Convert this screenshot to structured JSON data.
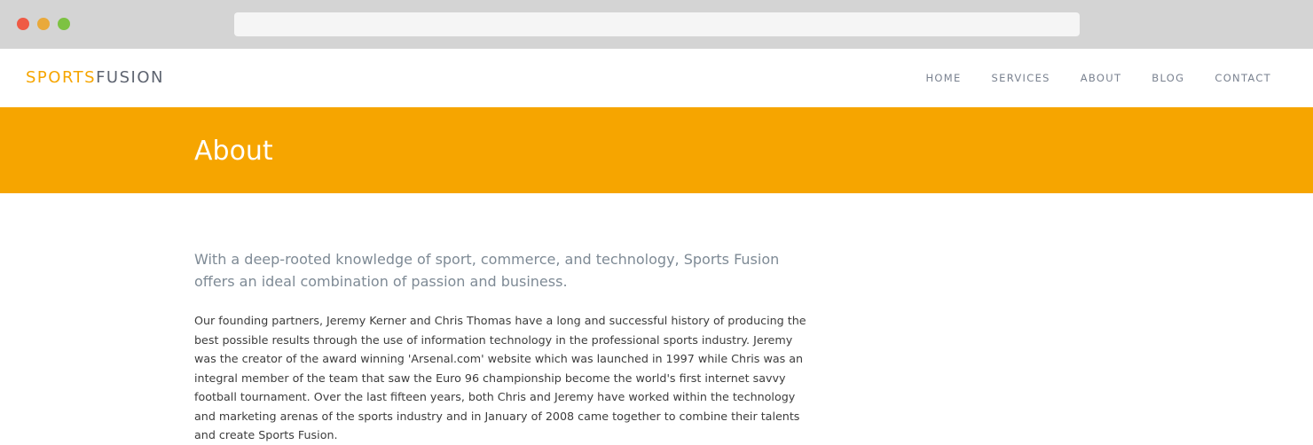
{
  "brand": {
    "logo_part1": "SPORTS",
    "logo_part2": "FUSION",
    "accent_color": "#f6a500"
  },
  "nav": {
    "items": [
      {
        "label": "HOME"
      },
      {
        "label": "SERVICES"
      },
      {
        "label": "ABOUT"
      },
      {
        "label": "BLOG"
      },
      {
        "label": "CONTACT"
      }
    ]
  },
  "banner": {
    "title": "About"
  },
  "content": {
    "lead": "With a deep-rooted knowledge of sport, commerce, and technology, Sports Fusion offers an ideal combination of passion and business.",
    "body": "Our founding partners, Jeremy Kerner and Chris Thomas have a long and successful history of producing the best possible results through the use of information technology in the professional sports industry. Jeremy was the creator of the award winning 'Arsenal.com' website which was launched in 1997 while Chris was an integral member of the team that saw the Euro 96 championship become the world's first internet savvy football tournament. Over the last fifteen years, both Chris and Jeremy have worked within the technology and marketing arenas of the sports industry and in January of 2008 came together to combine their talents and create Sports Fusion."
  }
}
